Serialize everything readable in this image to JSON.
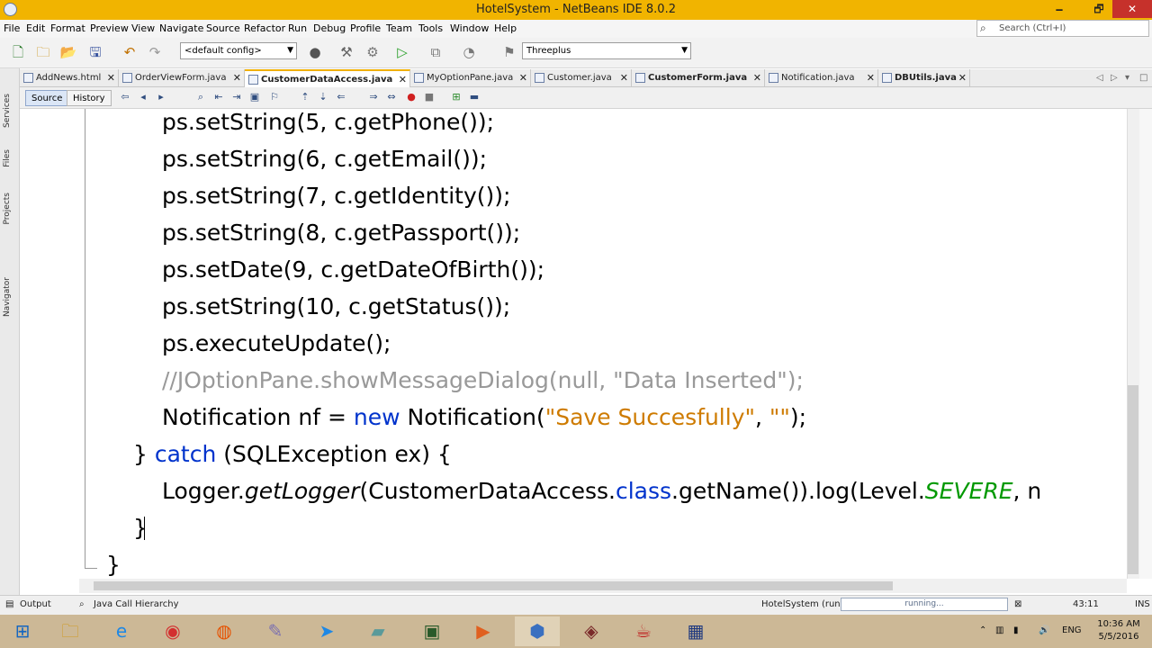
{
  "window": {
    "title": "HotelSystem - NetBeans IDE 8.0.2",
    "min": "🗕",
    "max": "🗗",
    "close": "✕"
  },
  "menu": [
    "File",
    "Edit",
    "Format",
    "Preview",
    "View",
    "Navigate",
    "Source",
    "Refactor",
    "Run",
    "Debug",
    "Profile",
    "Team",
    "Tools",
    "Window",
    "Help"
  ],
  "search": {
    "placeholder": "Search (Ctrl+I)"
  },
  "toolbar": {
    "config": "<default config>",
    "project": "Threeplus"
  },
  "tabs": [
    {
      "label": "AddNews.html",
      "active": false
    },
    {
      "label": "OrderViewForm.java",
      "active": false
    },
    {
      "label": "CustomerDataAccess.java",
      "active": true
    },
    {
      "label": "MyOptionPane.java",
      "active": false
    },
    {
      "label": "Customer.java",
      "active": false
    },
    {
      "label": "CustomerForm.java",
      "active": false
    },
    {
      "label": "Notification.java",
      "active": false
    },
    {
      "label": "DBUtils.java",
      "active": false
    }
  ],
  "side_panels": [
    "Services",
    "Files",
    "Projects",
    "Navigator"
  ],
  "editor_toolbar": {
    "source": "Source",
    "history": "History"
  },
  "code": {
    "l1": "ps.setString(5, c.getPhone());",
    "l2": "ps.setString(6, c.getEmail());",
    "l3": "ps.setString(7, c.getIdentity());",
    "l4": "ps.setString(8, c.getPassport());",
    "l5": "ps.setDate(9, c.getDateOfBirth());",
    "l6": "ps.setString(10, c.getStatus());",
    "l7": "ps.executeUpdate();",
    "l8": "//JOptionPane.showMessageDialog(null, \"Data Inserted\");",
    "l9a": "Notification nf = ",
    "l9b": "new",
    "l9c": " Notification(",
    "l9d": "\"Save Succesfully\"",
    "l9e": ", ",
    "l9f": "\"\"",
    "l9g": ");",
    "l10a": "} ",
    "l10b": "catch",
    "l10c": " (SQLException ex) {",
    "l11a": "Logger.",
    "l11b": "getLogger",
    "l11c": "(CustomerDataAccess.",
    "l11d": "class",
    "l11e": ".getName()).log(Level.",
    "l11f": "SEVERE",
    "l11g": ", n",
    "l12": "}",
    "l13": "}"
  },
  "status": {
    "output": "Output",
    "hierarchy": "Java Call Hierarchy",
    "run": "HotelSystem (run)",
    "progress": "running...",
    "position": "43:11",
    "mode": "INS"
  },
  "taskbar": {
    "lang": "ENG",
    "time": "10:36 AM",
    "date": "5/5/2016"
  }
}
